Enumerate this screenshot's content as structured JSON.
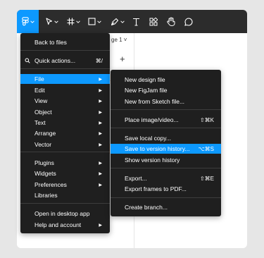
{
  "toolbar": {
    "tools": [
      {
        "icon": "figma-main-menu-icon"
      },
      {
        "icon": "move-tool-icon"
      },
      {
        "icon": "frame-tool-icon"
      },
      {
        "icon": "shape-tool-icon"
      },
      {
        "icon": "pen-tool-icon"
      },
      {
        "icon": "text-tool-icon"
      },
      {
        "icon": "resources-icon"
      },
      {
        "icon": "hand-tool-icon"
      },
      {
        "icon": "comment-icon"
      }
    ],
    "accent": "#0d99ff"
  },
  "background_panel": {
    "tab_label": "ge 1 ˅",
    "plus": "+"
  },
  "main_menu": {
    "back": "Back to files",
    "quick_actions": "Quick actions...",
    "quick_actions_shortcut": "⌘/",
    "file": "File",
    "edit": "Edit",
    "view": "View",
    "object": "Object",
    "text": "Text",
    "arrange": "Arrange",
    "vector": "Vector",
    "plugins": "Plugins",
    "widgets": "Widgets",
    "preferences": "Preferences",
    "libraries": "Libraries",
    "open_desktop": "Open in desktop app",
    "help": "Help and account"
  },
  "file_menu": {
    "new_design": "New design file",
    "new_figjam": "New FigJam file",
    "new_sketch": "New from Sketch file...",
    "place_image": "Place image/video...",
    "place_image_shortcut": "⇧⌘K",
    "save_local": "Save local copy...",
    "save_version": "Save to version history...",
    "save_version_shortcut": "⌥⌘S",
    "show_version": "Show version history",
    "export": "Export...",
    "export_shortcut": "⇧⌘E",
    "export_frames": "Export frames to PDF...",
    "create_branch": "Create branch..."
  },
  "glyphs": {
    "submenu_arrow": "▶"
  }
}
